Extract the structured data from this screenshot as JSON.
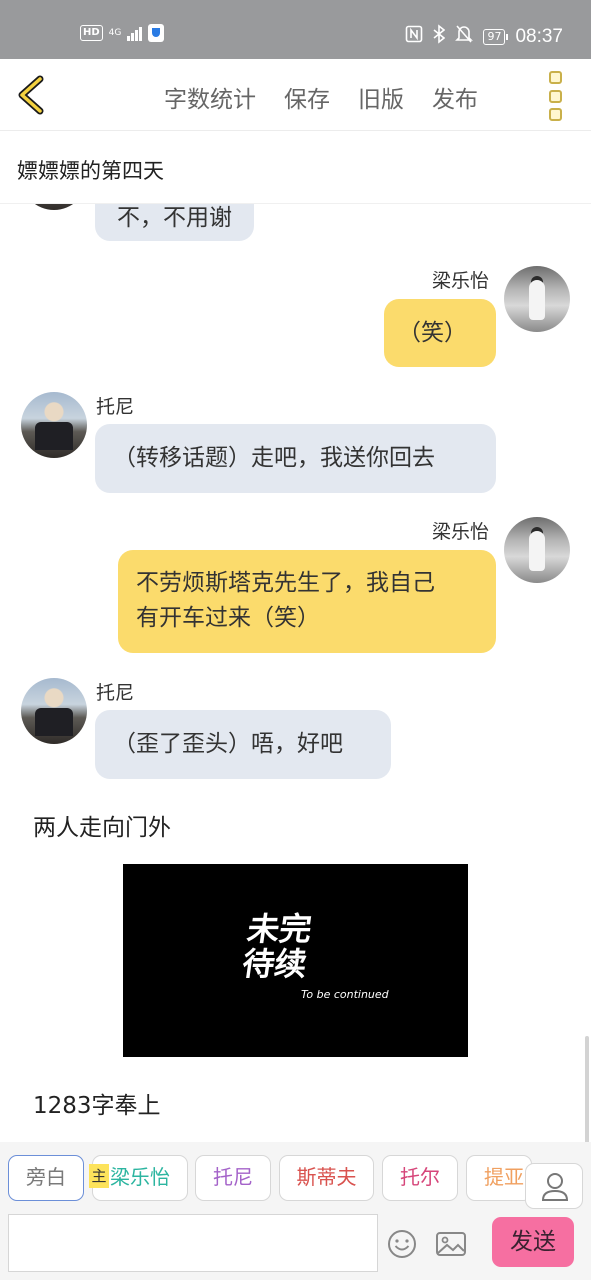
{
  "status_bar": {
    "hd": "HD",
    "network": "4G",
    "icons": [
      "nfc-icon",
      "bluetooth-icon",
      "mute-bell-icon"
    ],
    "battery": "97",
    "time": "08:37"
  },
  "header": {
    "back_icon": "chevron-left-icon",
    "actions": [
      "字数统计",
      "保存",
      "旧版",
      "发布"
    ],
    "more_icon": "more-vertical-icon",
    "accent": "#c9b04a"
  },
  "chapter_title": "嫖嫖嫖的第四天",
  "messages": [
    {
      "speaker": "",
      "side": "left",
      "text": "不，不用谢"
    },
    {
      "speaker": "梁乐怡",
      "side": "right",
      "text": "（笑）"
    },
    {
      "speaker": "托尼",
      "side": "left",
      "text": "（转移话题）走吧，我送你回去"
    },
    {
      "speaker": "梁乐怡",
      "side": "right",
      "text": [
        "不劳烦斯塔克先生了，我自己",
        "有开车过来（笑）"
      ]
    },
    {
      "speaker": "托尼",
      "side": "left",
      "text": "（歪了歪头）唔，好吧"
    }
  ],
  "narration_1": "两人走向门外",
  "image": {
    "title_line1": "未完",
    "title_line2": "待续",
    "subtitle": "To be continued"
  },
  "narration_2": "1283字奉上",
  "characters": {
    "host_tag": "主",
    "chips": [
      {
        "label": "旁白",
        "color": "#7a7a7a"
      },
      {
        "label": "梁乐怡",
        "color": "#2cb5a0"
      },
      {
        "label": "托尼",
        "color": "#a463c9"
      },
      {
        "label": "斯蒂夫",
        "color": "#d9534f"
      },
      {
        "label": "托尔",
        "color": "#d6467a"
      },
      {
        "label": "提亚",
        "color": "#f0a060"
      }
    ],
    "person_icon": "person-icon"
  },
  "input": {
    "placeholder": "",
    "emoji_icon": "emoji-icon",
    "image_icon": "image-icon",
    "send_label": "发送",
    "send_color": "#f66fa1"
  }
}
